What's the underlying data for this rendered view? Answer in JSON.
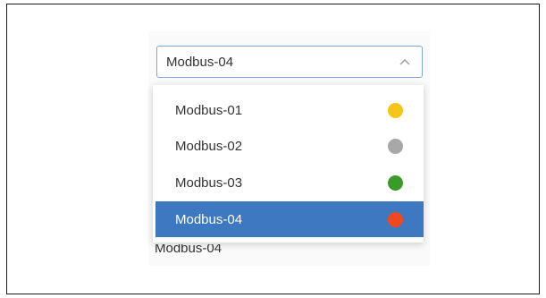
{
  "select": {
    "value": "Modbus-04",
    "icon": "chevron-up-icon"
  },
  "options": [
    {
      "label": "Modbus-01",
      "status_color": "#f5c518",
      "selected": false
    },
    {
      "label": "Modbus-02",
      "status_color": "#a8a8a8",
      "selected": false
    },
    {
      "label": "Modbus-03",
      "status_color": "#3a9a2a",
      "selected": false
    },
    {
      "label": "Modbus-04",
      "status_color": "#f0481e",
      "selected": true
    }
  ],
  "underlying_text": "Modbus-04",
  "colors": {
    "accent": "#3d78c0",
    "input_border": "#7fa6d8"
  }
}
